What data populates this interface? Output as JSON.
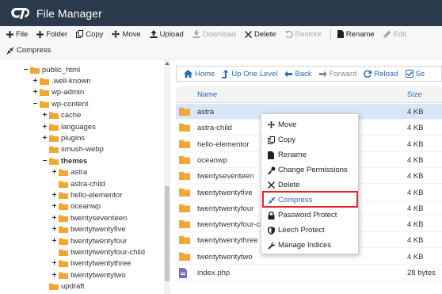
{
  "app": {
    "title": "File Manager",
    "colors": {
      "header_bg": "#293a4a",
      "link": "#2a6ab8",
      "folder": "#f0a733",
      "highlight_border": "#e02828",
      "selected_row": "#d7e7f7"
    }
  },
  "toolbar": {
    "items": [
      {
        "label": "File",
        "icon": "plus-icon",
        "disabled": false
      },
      {
        "label": "Folder",
        "icon": "plus-icon",
        "disabled": false
      },
      {
        "label": "Copy",
        "icon": "copy-icon",
        "disabled": false
      },
      {
        "label": "Move",
        "icon": "move-icon",
        "disabled": false
      },
      {
        "label": "Upload",
        "icon": "upload-icon",
        "disabled": false
      },
      {
        "label": "Download",
        "icon": "download-icon",
        "disabled": true
      },
      {
        "label": "Delete",
        "icon": "x-icon",
        "disabled": false
      },
      {
        "label": "Restore",
        "icon": "undo-icon",
        "disabled": true
      },
      {
        "label": "Rename",
        "icon": "file-icon",
        "disabled": false
      },
      {
        "label": "Edit",
        "icon": "pencil-icon",
        "disabled": true
      }
    ],
    "compress_label": "Compress"
  },
  "tree": {
    "items": [
      {
        "label": "public_html",
        "toggle": "−",
        "bold": false
      },
      {
        "label": ".well-known",
        "toggle": "+",
        "bold": false
      },
      {
        "label": "wp-admin",
        "toggle": "+",
        "bold": false
      },
      {
        "label": "wp-content",
        "toggle": "−",
        "bold": false
      },
      {
        "label": "cache",
        "toggle": "+",
        "bold": false
      },
      {
        "label": "languages",
        "toggle": "+",
        "bold": false
      },
      {
        "label": "plugins",
        "toggle": "+",
        "bold": false
      },
      {
        "label": "smush-webp",
        "toggle": "",
        "bold": false
      },
      {
        "label": "themes",
        "toggle": "−",
        "bold": true
      },
      {
        "label": "astra",
        "toggle": "+",
        "bold": false
      },
      {
        "label": "astra-child",
        "toggle": "",
        "bold": false
      },
      {
        "label": "hello-elementor",
        "toggle": "+",
        "bold": false
      },
      {
        "label": "oceanwp",
        "toggle": "+",
        "bold": false
      },
      {
        "label": "twentyseventeen",
        "toggle": "+",
        "bold": false
      },
      {
        "label": "twentytwentyfive",
        "toggle": "+",
        "bold": false
      },
      {
        "label": "twentytwentyfour",
        "toggle": "+",
        "bold": false
      },
      {
        "label": "twentytwentyfour-child",
        "toggle": "",
        "bold": false
      },
      {
        "label": "twentytwentythree",
        "toggle": "+",
        "bold": false
      },
      {
        "label": "twentytwentytwo",
        "toggle": "+",
        "bold": false
      },
      {
        "label": "updraft",
        "toggle": "",
        "bold": false
      }
    ]
  },
  "nav": {
    "items": [
      {
        "label": "Home",
        "icon": "home-icon",
        "disabled": false
      },
      {
        "label": "Up One Level",
        "icon": "level-up-icon",
        "disabled": false
      },
      {
        "label": "Back",
        "icon": "arrow-left-icon",
        "disabled": false
      },
      {
        "label": "Forward",
        "icon": "arrow-right-icon",
        "disabled": true
      },
      {
        "label": "Reload",
        "icon": "reload-icon",
        "disabled": false
      },
      {
        "label": "Se",
        "icon": "checkbox-icon",
        "disabled": false
      }
    ]
  },
  "table": {
    "headers": {
      "name": "Name",
      "size": "Size"
    },
    "rows": [
      {
        "name": "astra",
        "size": "4 KB",
        "type": "folder",
        "selected": true
      },
      {
        "name": "astra-child",
        "size": "4 KB",
        "type": "folder",
        "selected": false
      },
      {
        "name": "hello-elementor",
        "size": "4 KB",
        "type": "folder",
        "selected": false
      },
      {
        "name": "oceanwp",
        "size": "4 KB",
        "type": "folder",
        "selected": false
      },
      {
        "name": "twentyseventeen",
        "size": "4 KB",
        "type": "folder",
        "selected": false
      },
      {
        "name": "twentytwentyfive",
        "size": "4 KB",
        "type": "folder",
        "selected": false
      },
      {
        "name": "twentytwentyfour",
        "size": "4 KB",
        "type": "folder",
        "selected": false
      },
      {
        "name": "twentytwentyfour-ch",
        "size": "4 KB",
        "type": "folder",
        "selected": false
      },
      {
        "name": "twentytwentythree",
        "size": "4 KB",
        "type": "folder",
        "selected": false
      },
      {
        "name": "twentytwentytwo",
        "size": "4 KB",
        "type": "folder",
        "selected": false
      },
      {
        "name": "index.php",
        "size": "28 bytes",
        "type": "file",
        "selected": false
      }
    ]
  },
  "context_menu": {
    "items": [
      {
        "label": "Move",
        "icon": "move-icon"
      },
      {
        "label": "Copy",
        "icon": "copy-icon"
      },
      {
        "label": "Rename",
        "icon": "file-icon"
      },
      {
        "label": "Change Permissions",
        "icon": "key-icon"
      },
      {
        "label": "Delete",
        "icon": "x-icon"
      },
      {
        "label": "Compress",
        "icon": "compress-icon",
        "highlighted": true
      },
      {
        "label": "Password Protect",
        "icon": "lock-icon"
      },
      {
        "label": "Leech Protect",
        "icon": "shield-icon"
      },
      {
        "label": "Manage Indices",
        "icon": "wrench-icon"
      }
    ]
  }
}
